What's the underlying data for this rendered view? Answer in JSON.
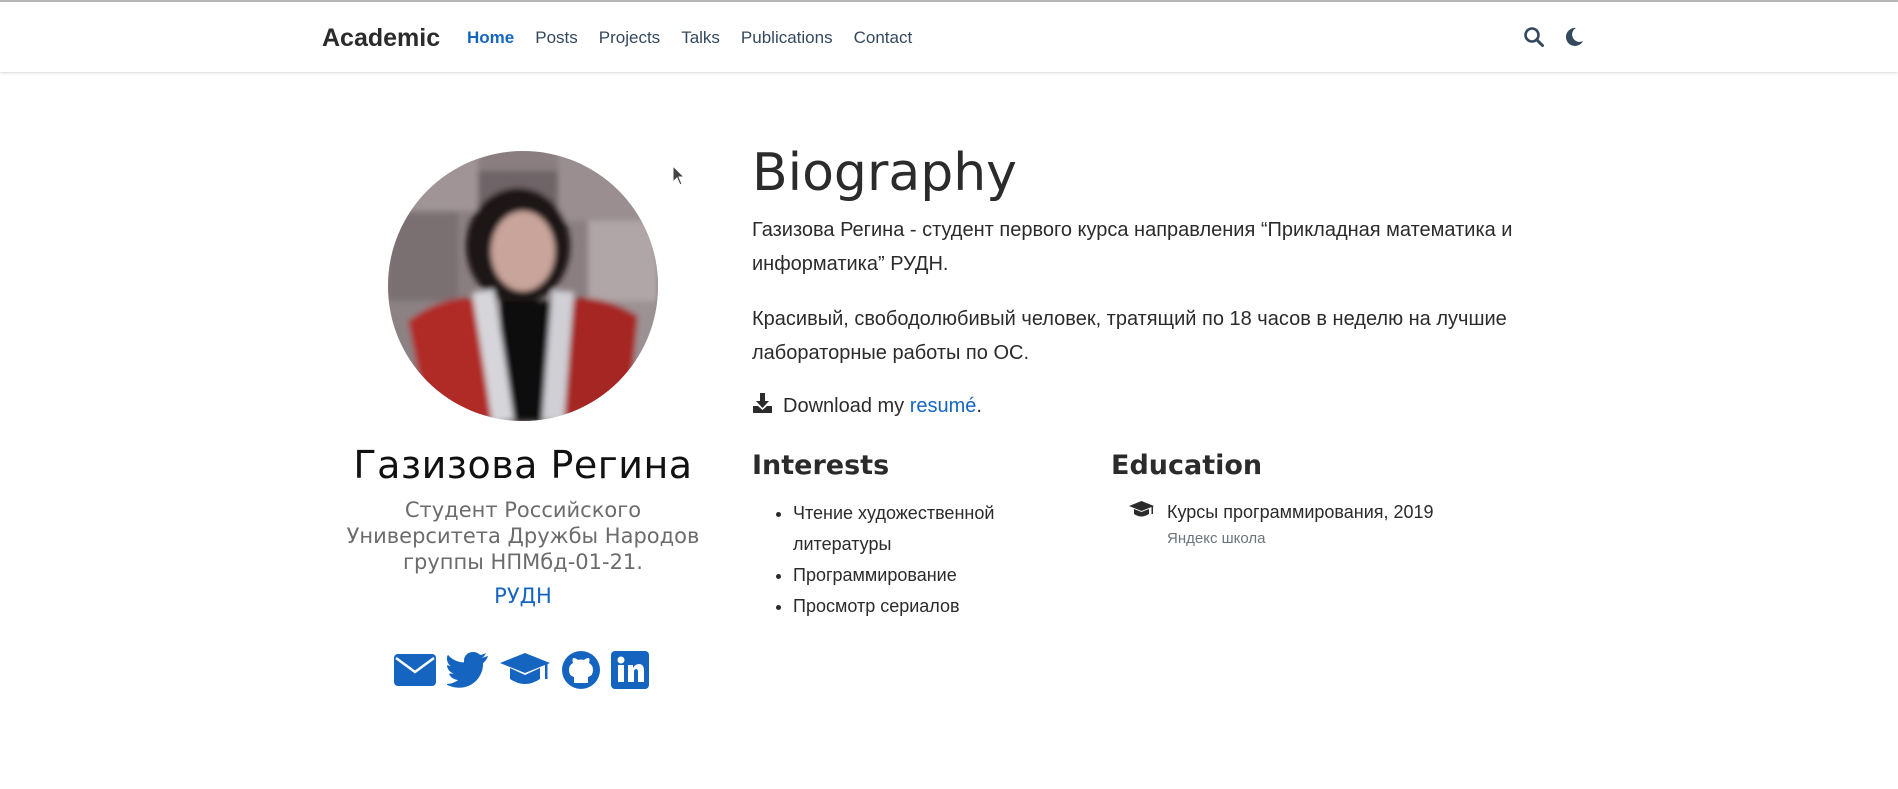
{
  "navbar": {
    "brand": "Academic",
    "items": [
      {
        "label": "Home",
        "active": true
      },
      {
        "label": "Posts"
      },
      {
        "label": "Projects"
      },
      {
        "label": "Talks"
      },
      {
        "label": "Publications"
      },
      {
        "label": "Contact"
      }
    ],
    "icons": [
      "search-icon",
      "moon-icon"
    ]
  },
  "profile": {
    "name": "Газизова Регина",
    "role": "Студент Российского Университета Дружбы Народов группы НПМбд-01-21.",
    "organization": "РУДН",
    "social": [
      "envelope-icon",
      "twitter-icon",
      "graduation-cap-icon",
      "github-icon",
      "linkedin-icon"
    ]
  },
  "biography": {
    "title": "Biography",
    "paragraph1": "Газизова Регина - студент первого курса направления “Прикладная математика и информатика” РУДН.",
    "paragraph2": "Красивый, свободолюбивый человек, тратящий по 18 часов в неделю на лучшие лабораторные работы по ОС.",
    "download_prefix": "Download my ",
    "download_link": "resumé",
    "download_suffix": "."
  },
  "interests": {
    "title": "Interests",
    "items": [
      "Чтение художественной литературы",
      "Программирование",
      "Просмотр сериалов"
    ]
  },
  "education": {
    "title": "Education",
    "items": [
      {
        "course": "Курсы программирования, 2019",
        "institution": "Яндекс школа"
      }
    ]
  },
  "colors": {
    "accent": "#1565c0",
    "text": "#2b2b2b",
    "muted": "#6c757d"
  }
}
